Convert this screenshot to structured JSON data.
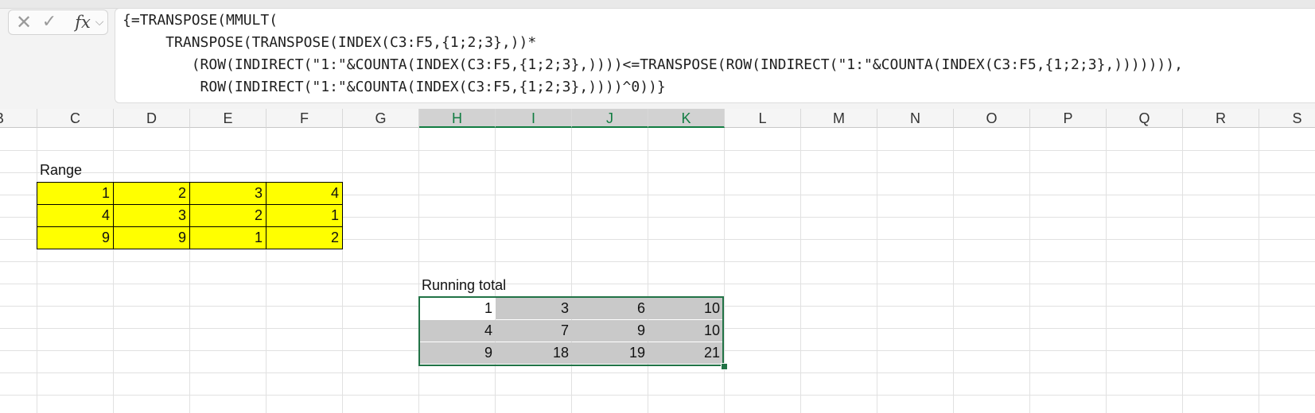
{
  "formula_bar": {
    "icons": [
      "close-icon",
      "check-icon",
      "fx-icon",
      "chevron-down-icon"
    ],
    "cancel_glyph": "✕",
    "enter_glyph": "✓",
    "fx_label": "fx",
    "chevron_glyph": "⌵",
    "lines": [
      "{=TRANSPOSE(MMULT(",
      "     TRANSPOSE(TRANSPOSE(INDEX(C3:F5,{1;2;3},))*",
      "        (ROW(INDIRECT(\"1:\"&COUNTA(INDEX(C3:F5,{1;2;3},))))<=TRANSPOSE(ROW(INDIRECT(\"1:\"&COUNTA(INDEX(C3:F5,{1;2;3},))))))),",
      "         ROW(INDIRECT(\"1:\"&COUNTA(INDEX(C3:F5,{1;2;3},))))^0))}"
    ]
  },
  "columns": [
    "B",
    "C",
    "D",
    "E",
    "F",
    "G",
    "H",
    "I",
    "J",
    "K",
    "L",
    "M",
    "N",
    "O",
    "P",
    "Q",
    "R",
    "S"
  ],
  "selected_columns": [
    "H",
    "I",
    "J",
    "K"
  ],
  "range_block": {
    "label": "Range",
    "rows": [
      [
        "1",
        "2",
        "3",
        "4"
      ],
      [
        "4",
        "3",
        "2",
        "1"
      ],
      [
        "9",
        "9",
        "1",
        "2"
      ]
    ],
    "fill_color": "#ffff00"
  },
  "running_total_block": {
    "label": "Running total",
    "rows": [
      [
        "1",
        "3",
        "6",
        "10"
      ],
      [
        "4",
        "7",
        "9",
        "10"
      ],
      [
        "9",
        "18",
        "19",
        "21"
      ]
    ],
    "fill_color": "#c9c9c9",
    "selection_color": "#217346"
  }
}
